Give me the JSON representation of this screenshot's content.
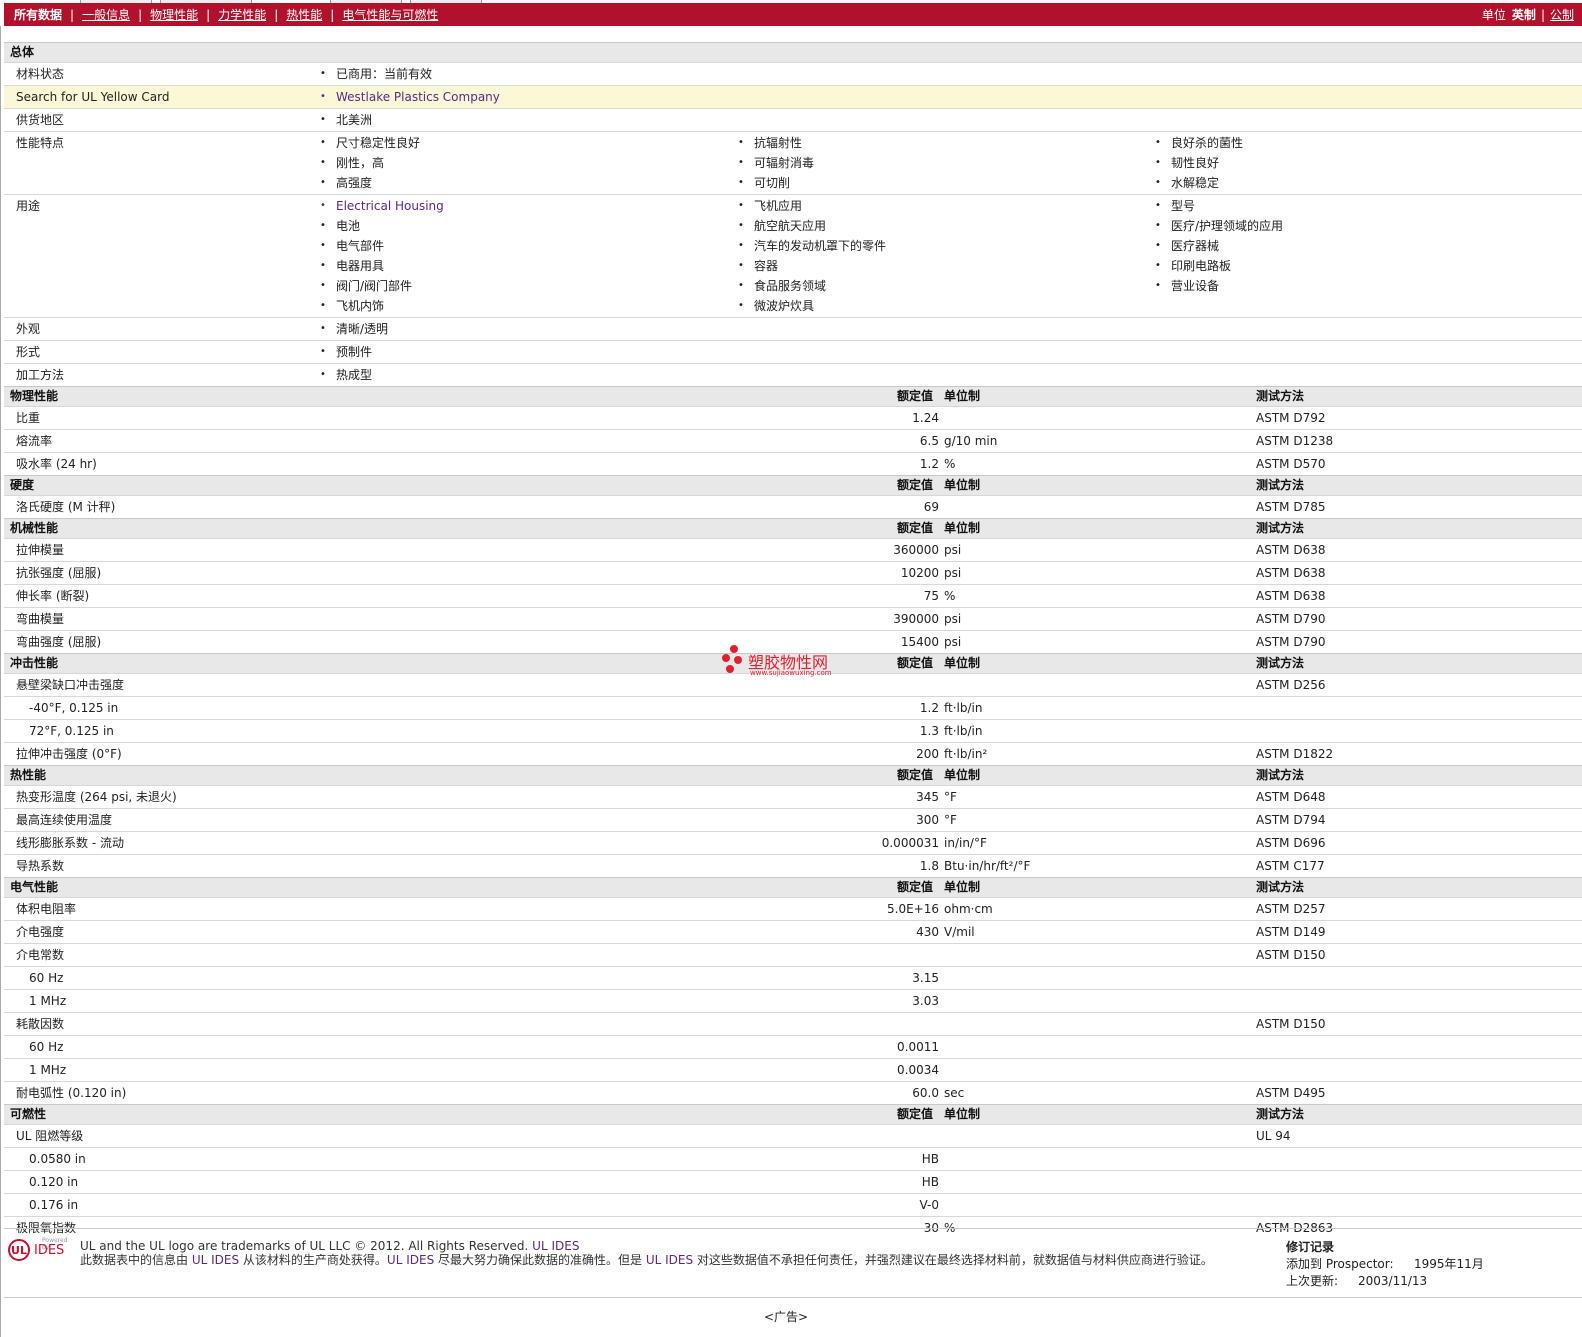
{
  "nav": {
    "tabs": [
      "所有数据",
      "一般信息",
      "物理性能",
      "力学性能",
      "热性能",
      "电气性能与可燃性"
    ],
    "unit_label": "单位",
    "imperial": "英制",
    "metric": "公制"
  },
  "general": {
    "title": "总体",
    "material_status_label": "材料状态",
    "material_status": "已商用：当前有效",
    "yellow_card_label": "Search for UL Yellow Card",
    "yellow_card_value": "Westlake Plastics Company",
    "region_label": "供货地区",
    "region": "北美洲",
    "features_label": "性能特点",
    "features": [
      [
        "尺寸稳定性良好",
        "刚性，高",
        "高强度"
      ],
      [
        "抗辐射性",
        "可辐射消毒",
        "可切削"
      ],
      [
        "良好杀的菌性",
        "韧性良好",
        "水解稳定"
      ]
    ],
    "uses_label": "用途",
    "uses": [
      [
        "Electrical Housing",
        "电池",
        "电气部件",
        "电器用具",
        "阀门/阀门部件",
        "飞机内饰"
      ],
      [
        "飞机应用",
        "航空航天应用",
        "汽车的发动机罩下的零件",
        "容器",
        "食品服务领域",
        "微波炉炊具"
      ],
      [
        "型号",
        "医疗/护理领域的应用",
        "医疗器械",
        "印刷电路板",
        "营业设备"
      ]
    ],
    "appearance_label": "外观",
    "appearance": "清晰/透明",
    "form_label": "形式",
    "form": "预制件",
    "processing_label": "加工方法",
    "processing": "热成型"
  },
  "headers": {
    "nominal": "额定值",
    "unit": "单位制",
    "test": "测试方法"
  },
  "sections": [
    {
      "title": "物理性能",
      "rows": [
        {
          "label": "比重",
          "value": "1.24",
          "unit": "",
          "test": "ASTM D792"
        },
        {
          "label": "熔流率",
          "value": "6.5",
          "unit": "g/10 min",
          "test": "ASTM D1238"
        },
        {
          "label": "吸水率 (24 hr)",
          "value": "1.2",
          "unit": "%",
          "test": "ASTM D570"
        }
      ]
    },
    {
      "title": "硬度",
      "rows": [
        {
          "label": "洛氏硬度 (M 计秤)",
          "value": "69",
          "unit": "",
          "test": "ASTM D785"
        }
      ]
    },
    {
      "title": "机械性能",
      "rows": [
        {
          "label": "拉伸模量",
          "value": "360000",
          "unit": "psi",
          "test": "ASTM D638"
        },
        {
          "label": "抗张强度 (屈服)",
          "value": "10200",
          "unit": "psi",
          "test": "ASTM D638"
        },
        {
          "label": "伸长率 (断裂)",
          "value": "75",
          "unit": "%",
          "test": "ASTM D638"
        },
        {
          "label": "弯曲模量",
          "value": "390000",
          "unit": "psi",
          "test": "ASTM D790"
        },
        {
          "label": "弯曲强度 (屈服)",
          "value": "15400",
          "unit": "psi",
          "test": "ASTM D790"
        }
      ]
    },
    {
      "title": "冲击性能",
      "rows": [
        {
          "label": "悬壁梁缺口冲击强度",
          "value": "",
          "unit": "",
          "test": "ASTM D256"
        },
        {
          "label": "-40°F, 0.125 in",
          "value": "1.2",
          "unit": "ft·lb/in",
          "test": "",
          "sub": true
        },
        {
          "label": "72°F, 0.125 in",
          "value": "1.3",
          "unit": "ft·lb/in",
          "test": "",
          "sub": true
        },
        {
          "label": "拉伸冲击强度 (0°F)",
          "value": "200",
          "unit": "ft·lb/in²",
          "test": "ASTM D1822"
        }
      ]
    },
    {
      "title": "热性能",
      "rows": [
        {
          "label": "热变形温度 (264 psi, 未退火)",
          "value": "345",
          "unit": "°F",
          "test": "ASTM D648"
        },
        {
          "label": "最高连续使用温度",
          "value": "300",
          "unit": "°F",
          "test": "ASTM D794"
        },
        {
          "label": "线形膨胀系数 - 流动",
          "value": "0.000031",
          "unit": "in/in/°F",
          "test": "ASTM D696"
        },
        {
          "label": "导热系数",
          "value": "1.8",
          "unit": "Btu·in/hr/ft²/°F",
          "test": "ASTM C177"
        }
      ]
    },
    {
      "title": "电气性能",
      "rows": [
        {
          "label": "体积电阻率",
          "value": "5.0E+16",
          "unit": "ohm·cm",
          "test": "ASTM D257"
        },
        {
          "label": "介电强度",
          "value": "430",
          "unit": "V/mil",
          "test": "ASTM D149"
        },
        {
          "label": "介电常数",
          "value": "",
          "unit": "",
          "test": "ASTM D150"
        },
        {
          "label": "60 Hz",
          "value": "3.15",
          "unit": "",
          "test": "",
          "sub": true
        },
        {
          "label": "1 MHz",
          "value": "3.03",
          "unit": "",
          "test": "",
          "sub": true
        },
        {
          "label": "耗散因数",
          "value": "",
          "unit": "",
          "test": "ASTM D150"
        },
        {
          "label": "60 Hz",
          "value": "0.0011",
          "unit": "",
          "test": "",
          "sub": true
        },
        {
          "label": "1 MHz",
          "value": "0.0034",
          "unit": "",
          "test": "",
          "sub": true
        },
        {
          "label": "耐电弧性 (0.120 in)",
          "value": "60.0",
          "unit": "sec",
          "test": "ASTM D495"
        }
      ]
    },
    {
      "title": "可燃性",
      "rows": [
        {
          "label": "UL 阻燃等级",
          "value": "",
          "unit": "",
          "test": "UL 94"
        },
        {
          "label": "0.0580 in",
          "value": "HB",
          "unit": "",
          "test": "",
          "sub": true
        },
        {
          "label": "0.120 in",
          "value": "HB",
          "unit": "",
          "test": "",
          "sub": true
        },
        {
          "label": "0.176 in",
          "value": "V-0",
          "unit": "",
          "test": "",
          "sub": true
        },
        {
          "label": "极限氧指数",
          "value": "30",
          "unit": "%",
          "test": "ASTM D2863"
        }
      ]
    }
  ],
  "watermark": {
    "name": "塑胶物性网",
    "url": "www.sujiaowuxing.com"
  },
  "footer": {
    "logo_ul": "UL",
    "logo_ides": "IDES",
    "powered": "Powered by",
    "trademark_a": "UL and the UL logo are trademarks of UL LLC © 2012. All Rights Reserved. ",
    "trademark_link": "UL IDES",
    "disclaimer_1": "此数据表中的信息由 ",
    "disclaimer_link1": "UL IDES",
    "disclaimer_2": " 从该材料的生产商处获得。",
    "disclaimer_link2": "UL IDES",
    "disclaimer_3": " 尽最大努力确保此数据的准确性。但是 ",
    "disclaimer_link3": "UL IDES",
    "disclaimer_4": " 对这些数据值不承担任何责任，并强烈建议在最终选择材料前，就数据值与材料供应商进行验证。",
    "revision_title": "修订记录",
    "added_label": "添加到 Prospector:",
    "added_value": "1995年11月",
    "updated_label": "上次更新:",
    "updated_value": "2003/11/13",
    "ad": "<广告>"
  }
}
